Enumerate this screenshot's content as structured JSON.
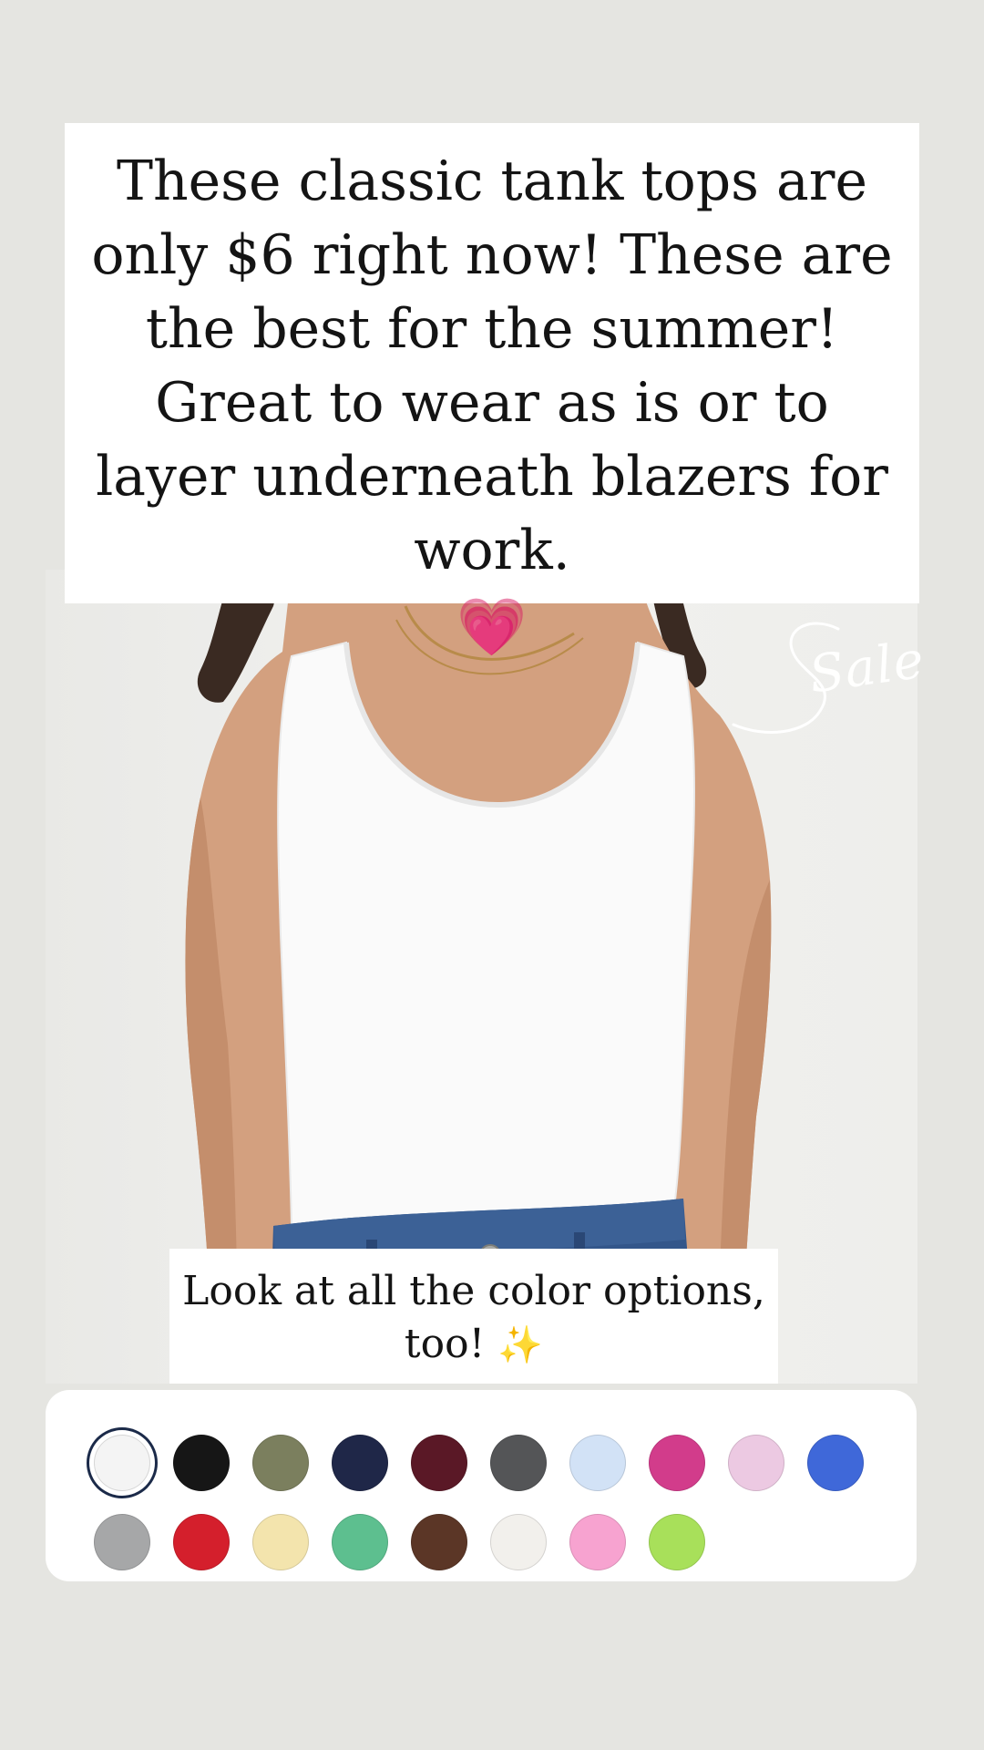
{
  "caption_top": {
    "text": "These classic tank tops are only $6 right now! These are the best for the summer! Great to wear as is or to layer underneath blazers for work.",
    "emoji": "💗"
  },
  "sale_sticker": {
    "text": "Sale"
  },
  "caption_bottom": {
    "line1": "Look at all the color options,",
    "line2": "too!",
    "emoji": "✨"
  },
  "swatches": {
    "selected_index": 0,
    "colors": [
      "#f4f4f4",
      "#161616",
      "#7b7f5e",
      "#1f2748",
      "#5a1826",
      "#545557",
      "#d2e2f6",
      "#d23c8b",
      "#ecc9e2",
      "#3f68d9",
      "#a6a7a8",
      "#d41f2c",
      "#f3e4ad",
      "#5dbf8f",
      "#5b3626",
      "#f2f0ec",
      "#f7a3d0",
      "#a8e05a"
    ]
  }
}
